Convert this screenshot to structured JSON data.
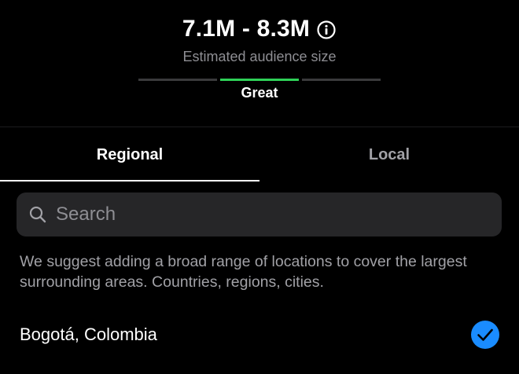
{
  "audience": {
    "range": "7.1M - 8.3M",
    "subtitle": "Estimated audience size",
    "rating": "Great",
    "meter_level": 2,
    "meter_total": 3,
    "meter_color": "#2fd158",
    "info_icon": "info-circle-icon"
  },
  "tabs": [
    {
      "label": "Regional",
      "selected": true
    },
    {
      "label": "Local",
      "selected": false
    }
  ],
  "search": {
    "placeholder": "Search",
    "value": "",
    "icon": "search-icon"
  },
  "hint": "We suggest adding a broad range of locations to cover the largest surrounding areas. Countries, regions, cities.",
  "locations": [
    {
      "name": "Bogotá, Colombia",
      "selected": true,
      "check_color": "#1a8cff",
      "icon": "checkmark-circle-icon"
    }
  ]
}
